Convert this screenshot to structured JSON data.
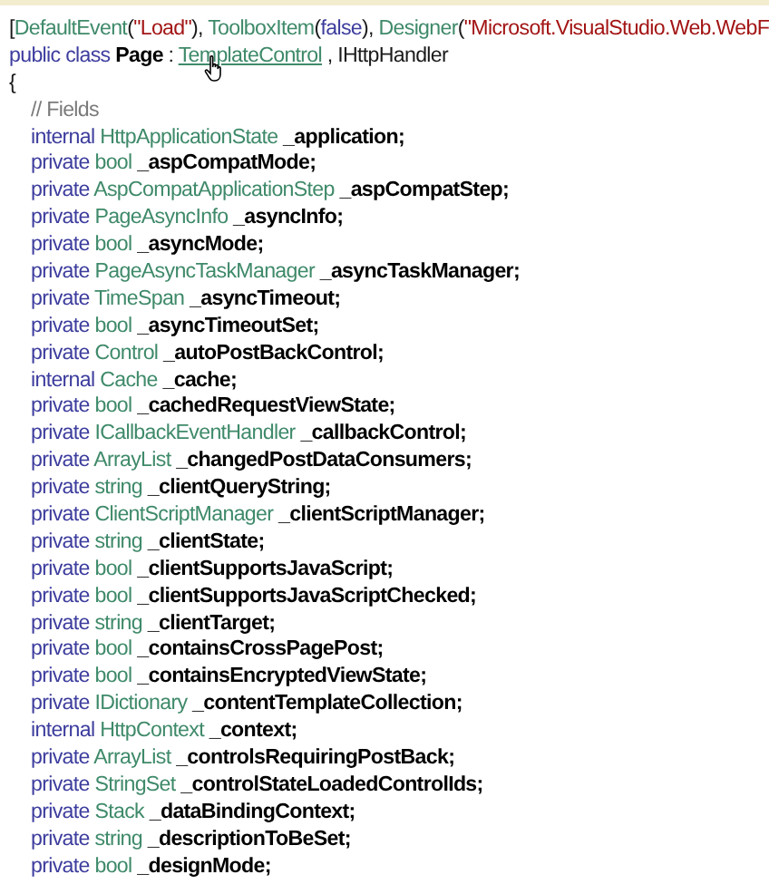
{
  "attribute_line": [
    {
      "kind": "plain",
      "text": "["
    },
    {
      "kind": "type",
      "text": "DefaultEvent"
    },
    {
      "kind": "plain",
      "text": "("
    },
    {
      "kind": "string",
      "text": "\"Load\""
    },
    {
      "kind": "plain",
      "text": "), "
    },
    {
      "kind": "type",
      "text": "ToolboxItem"
    },
    {
      "kind": "plain",
      "text": "("
    },
    {
      "kind": "keyword",
      "text": "false"
    },
    {
      "kind": "plain",
      "text": "), "
    },
    {
      "kind": "type",
      "text": "Designer"
    },
    {
      "kind": "plain",
      "text": "("
    },
    {
      "kind": "string",
      "text": "\"Microsoft.VisualStudio.Web.WebF"
    }
  ],
  "class_declaration": {
    "keywords": "public class",
    "name": "Page",
    "separator": ":",
    "base": "TemplateControl",
    "rest": ", IHttpHandler"
  },
  "open_brace": "{",
  "comment": "// Fields",
  "fields": [
    {
      "modifier": "internal",
      "type": "HttpApplicationState",
      "name": "_application;"
    },
    {
      "modifier": "private",
      "type": "bool",
      "name": "_aspCompatMode;"
    },
    {
      "modifier": "private",
      "type": "AspCompatApplicationStep",
      "name": "_aspCompatStep;"
    },
    {
      "modifier": "private",
      "type": "PageAsyncInfo",
      "name": "_asyncInfo;"
    },
    {
      "modifier": "private",
      "type": "bool",
      "name": "_asyncMode;"
    },
    {
      "modifier": "private",
      "type": "PageAsyncTaskManager",
      "name": "_asyncTaskManager;"
    },
    {
      "modifier": "private",
      "type": "TimeSpan",
      "name": "_asyncTimeout;"
    },
    {
      "modifier": "private",
      "type": "bool",
      "name": "_asyncTimeoutSet;"
    },
    {
      "modifier": "private",
      "type": "Control",
      "name": "_autoPostBackControl;"
    },
    {
      "modifier": "internal",
      "type": "Cache",
      "name": "_cache;"
    },
    {
      "modifier": "private",
      "type": "bool",
      "name": "_cachedRequestViewState;"
    },
    {
      "modifier": "private",
      "type": "ICallbackEventHandler",
      "name": "_callbackControl;"
    },
    {
      "modifier": "private",
      "type": "ArrayList",
      "name": "_changedPostDataConsumers;"
    },
    {
      "modifier": "private",
      "type": "string",
      "name": "_clientQueryString;"
    },
    {
      "modifier": "private",
      "type": "ClientScriptManager",
      "name": "_clientScriptManager;"
    },
    {
      "modifier": "private",
      "type": "string",
      "name": "_clientState;"
    },
    {
      "modifier": "private",
      "type": "bool",
      "name": "_clientSupportsJavaScript;"
    },
    {
      "modifier": "private",
      "type": "bool",
      "name": "_clientSupportsJavaScriptChecked;"
    },
    {
      "modifier": "private",
      "type": "string",
      "name": "_clientTarget;"
    },
    {
      "modifier": "private",
      "type": "bool",
      "name": "_containsCrossPagePost;"
    },
    {
      "modifier": "private",
      "type": "bool",
      "name": "_containsEncryptedViewState;"
    },
    {
      "modifier": "private",
      "type": "IDictionary",
      "name": "_contentTemplateCollection;"
    },
    {
      "modifier": "internal",
      "type": "HttpContext",
      "name": "_context;"
    },
    {
      "modifier": "private",
      "type": "ArrayList",
      "name": "_controlsRequiringPostBack;"
    },
    {
      "modifier": "private",
      "type": "StringSet",
      "name": "_controlStateLoadedControlIds;"
    },
    {
      "modifier": "private",
      "type": "Stack",
      "name": "_dataBindingContext;"
    },
    {
      "modifier": "private",
      "type": "string",
      "name": "_descriptionToBeSet;"
    },
    {
      "modifier": "private",
      "type": "bool",
      "name": "_designMode;"
    }
  ]
}
